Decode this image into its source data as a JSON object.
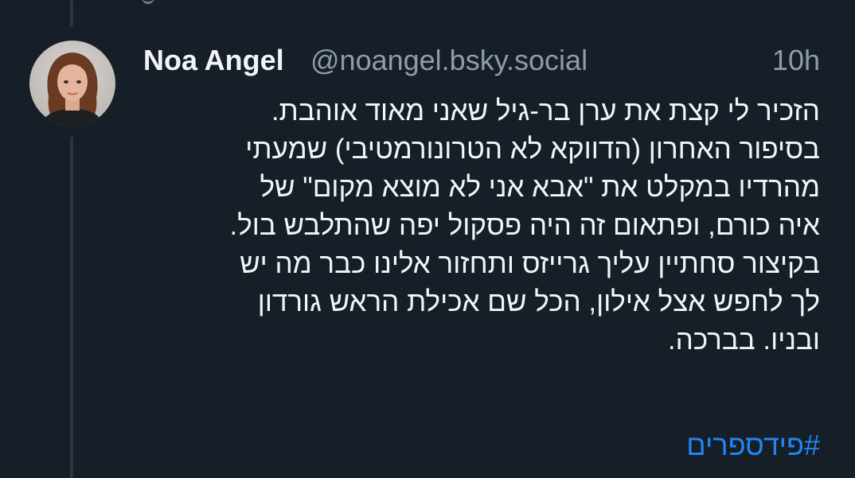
{
  "post": {
    "author": {
      "display_name": "Noa Angel",
      "handle": "@noangel.bsky.social"
    },
    "timestamp": "10h",
    "text_lines": [
      "הזכיר לי קצת את ערן בר-גיל שאני מאוד אוהבת.",
      "בסיפור האחרון (הדווקא לא הטרונורמטיבי) שמעתי",
      "מהרדיו במקלט את \"אבא אני לא מוצא מקום\" של",
      "איה כורם, ופתאום זה היה פסקול יפה שהתלבש בול.",
      "בקיצור סחתיין עליך גרייזס ותחזור אלינו כבר מה יש",
      "לך לחפש אצל אילון, הכל שם אכילת הראש גורדון",
      "ובניו. בברכה."
    ],
    "hashtag": "#פידספרים"
  },
  "colors": {
    "background": "#161e27",
    "text": "#f2f5f8",
    "muted": "#8e9cac",
    "link": "#1f86f2",
    "thread_line": "#2a3644"
  }
}
